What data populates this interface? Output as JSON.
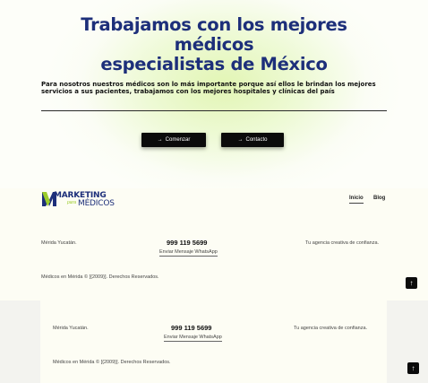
{
  "hero": {
    "title_lines": [
      "Trabajamos con los mejores",
      "médicos",
      "especialistas de México"
    ],
    "description": "Para nosotros nuestros médicos son lo más importante porque así ellos le brindan los mejores servicios a sus pacientes, trabajamos con los mejores hospitales y clínicas del país",
    "buttons": {
      "start_label": "Comenzar",
      "contact_label": "Contacto",
      "arrow": "→"
    }
  },
  "header": {
    "logo": {
      "top_text": "MARKETING",
      "para_text": "para",
      "bottom_text": "MÉDICOS",
      "colors": {
        "navy": "#1d2f7a",
        "green": "#9ccc2c"
      }
    },
    "nav": [
      {
        "label": "Inicio",
        "active": true
      },
      {
        "label": "Blog",
        "active": false
      }
    ]
  },
  "footer": {
    "city": "Mérida Yucatán.",
    "phone": "999 119 5699",
    "whatsapp_link": "Enviar Mensaje WhatsApp",
    "tagline": "Tu agencia creativa de confianza.",
    "copyright": "Médicos en Mérida © [{2009}]. Derechos Reservados."
  },
  "scroll_top_icon": "↑"
}
